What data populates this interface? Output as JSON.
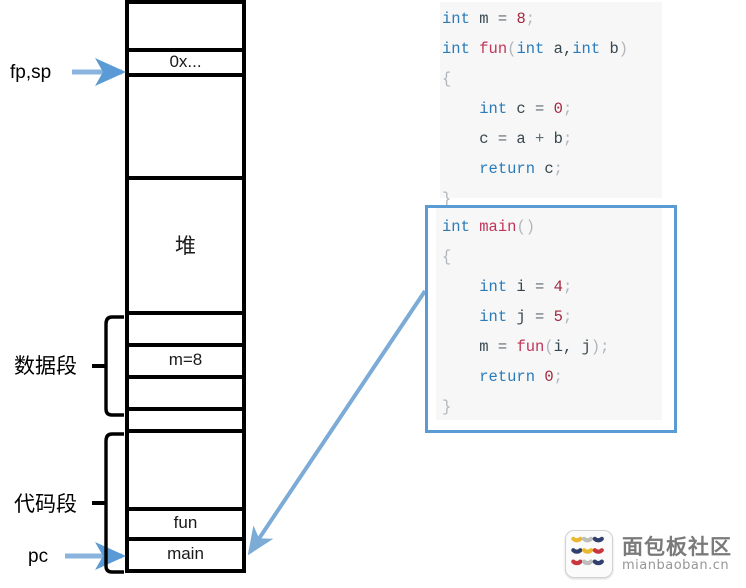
{
  "diagram": {
    "title": "Process memory layout with stack, heap, data segment and code segment",
    "colors": {
      "arrow_blue": "#5b9bd5",
      "box_border_blue": "#5b9bd5",
      "cell_border": "#000000",
      "code_bg": "#f7f7f7",
      "keyword": "#2b7bb9",
      "function_name": "#c0365a",
      "number": "#a0293f",
      "identifier": "#37474f",
      "punctuation": "#b0b6bb"
    }
  },
  "memory": {
    "cells": [
      {
        "label": "",
        "name": "stack-empty-top"
      },
      {
        "label": "0x...",
        "name": "stack-return-address"
      },
      {
        "label": "",
        "name": "stack-free-region"
      },
      {
        "label": "堆",
        "name": "heap-region"
      },
      {
        "label": "",
        "name": "data-cell-upper"
      },
      {
        "label": "m=8",
        "name": "data-cell-global-m"
      },
      {
        "label": "",
        "name": "data-cell-lower"
      },
      {
        "label": "",
        "name": "data-cell-bottom"
      },
      {
        "label": "",
        "name": "code-cell-free"
      },
      {
        "label": "fun",
        "name": "code-cell-fun"
      },
      {
        "label": "main",
        "name": "code-cell-main"
      }
    ]
  },
  "labels": {
    "fp_sp": "fp,sp",
    "pc": "pc",
    "data_segment": "数据段",
    "code_segment": "代码段"
  },
  "code_fun": {
    "lines": [
      [
        {
          "t": "int",
          "c": "key"
        },
        {
          "t": " m ",
          "c": "id"
        },
        {
          "t": "=",
          "c": "op"
        },
        {
          "t": " ",
          "c": "id"
        },
        {
          "t": "8",
          "c": "num"
        },
        {
          "t": ";",
          "c": "pun"
        }
      ],
      [
        {
          "t": "int ",
          "c": "key"
        },
        {
          "t": "fun",
          "c": "fn"
        },
        {
          "t": "(",
          "c": "pun"
        },
        {
          "t": "int",
          "c": "key"
        },
        {
          "t": " a,",
          "c": "id"
        },
        {
          "t": "int",
          "c": "key"
        },
        {
          "t": " b",
          "c": "id"
        },
        {
          "t": ")",
          "c": "pun"
        }
      ],
      [
        {
          "t": "{",
          "c": "pun"
        }
      ],
      [
        {
          "t": "    ",
          "c": "id"
        },
        {
          "t": "int",
          "c": "key"
        },
        {
          "t": " c ",
          "c": "id"
        },
        {
          "t": "=",
          "c": "op"
        },
        {
          "t": " ",
          "c": "id"
        },
        {
          "t": "0",
          "c": "num"
        },
        {
          "t": ";",
          "c": "pun"
        }
      ],
      [
        {
          "t": "    c ",
          "c": "id"
        },
        {
          "t": "=",
          "c": "op"
        },
        {
          "t": " a ",
          "c": "id"
        },
        {
          "t": "+",
          "c": "op"
        },
        {
          "t": " b",
          "c": "id"
        },
        {
          "t": ";",
          "c": "pun"
        }
      ],
      [
        {
          "t": "    ",
          "c": "id"
        },
        {
          "t": "return",
          "c": "key"
        },
        {
          "t": " c",
          "c": "id"
        },
        {
          "t": ";",
          "c": "pun"
        }
      ],
      [
        {
          "t": "}",
          "c": "pun"
        }
      ]
    ],
    "plain": "int m = 8;\nint fun(int a,int b)\n{\n    int c = 0;\n    c = a + b;\n    return c;\n}"
  },
  "code_main": {
    "lines": [
      [
        {
          "t": "int ",
          "c": "key"
        },
        {
          "t": "main",
          "c": "fn"
        },
        {
          "t": "()",
          "c": "pun"
        }
      ],
      [
        {
          "t": "{",
          "c": "pun"
        }
      ],
      [
        {
          "t": "    ",
          "c": "id"
        },
        {
          "t": "int",
          "c": "key"
        },
        {
          "t": " i ",
          "c": "id"
        },
        {
          "t": "=",
          "c": "op"
        },
        {
          "t": " ",
          "c": "id"
        },
        {
          "t": "4",
          "c": "num"
        },
        {
          "t": ";",
          "c": "pun"
        }
      ],
      [
        {
          "t": "    ",
          "c": "id"
        },
        {
          "t": "int",
          "c": "key"
        },
        {
          "t": " j ",
          "c": "id"
        },
        {
          "t": "=",
          "c": "op"
        },
        {
          "t": " ",
          "c": "id"
        },
        {
          "t": "5",
          "c": "num"
        },
        {
          "t": ";",
          "c": "pun"
        }
      ],
      [
        {
          "t": "    m ",
          "c": "id"
        },
        {
          "t": "=",
          "c": "op"
        },
        {
          "t": " ",
          "c": "id"
        },
        {
          "t": "fun",
          "c": "fn"
        },
        {
          "t": "(",
          "c": "pun"
        },
        {
          "t": "i, j",
          "c": "id"
        },
        {
          "t": ");",
          "c": "pun"
        }
      ],
      [
        {
          "t": "    ",
          "c": "id"
        },
        {
          "t": "return",
          "c": "key"
        },
        {
          "t": " ",
          "c": "id"
        },
        {
          "t": "0",
          "c": "num"
        },
        {
          "t": ";",
          "c": "pun"
        }
      ],
      [
        {
          "t": "}",
          "c": "pun"
        }
      ]
    ],
    "plain": "int main()\n{\n    int i = 4;\n    int j = 5;\n    m = fun(i, j);\n    return 0;\n}"
  },
  "watermark": {
    "cn": "面包板社区",
    "en": "mianbaoban.cn"
  }
}
